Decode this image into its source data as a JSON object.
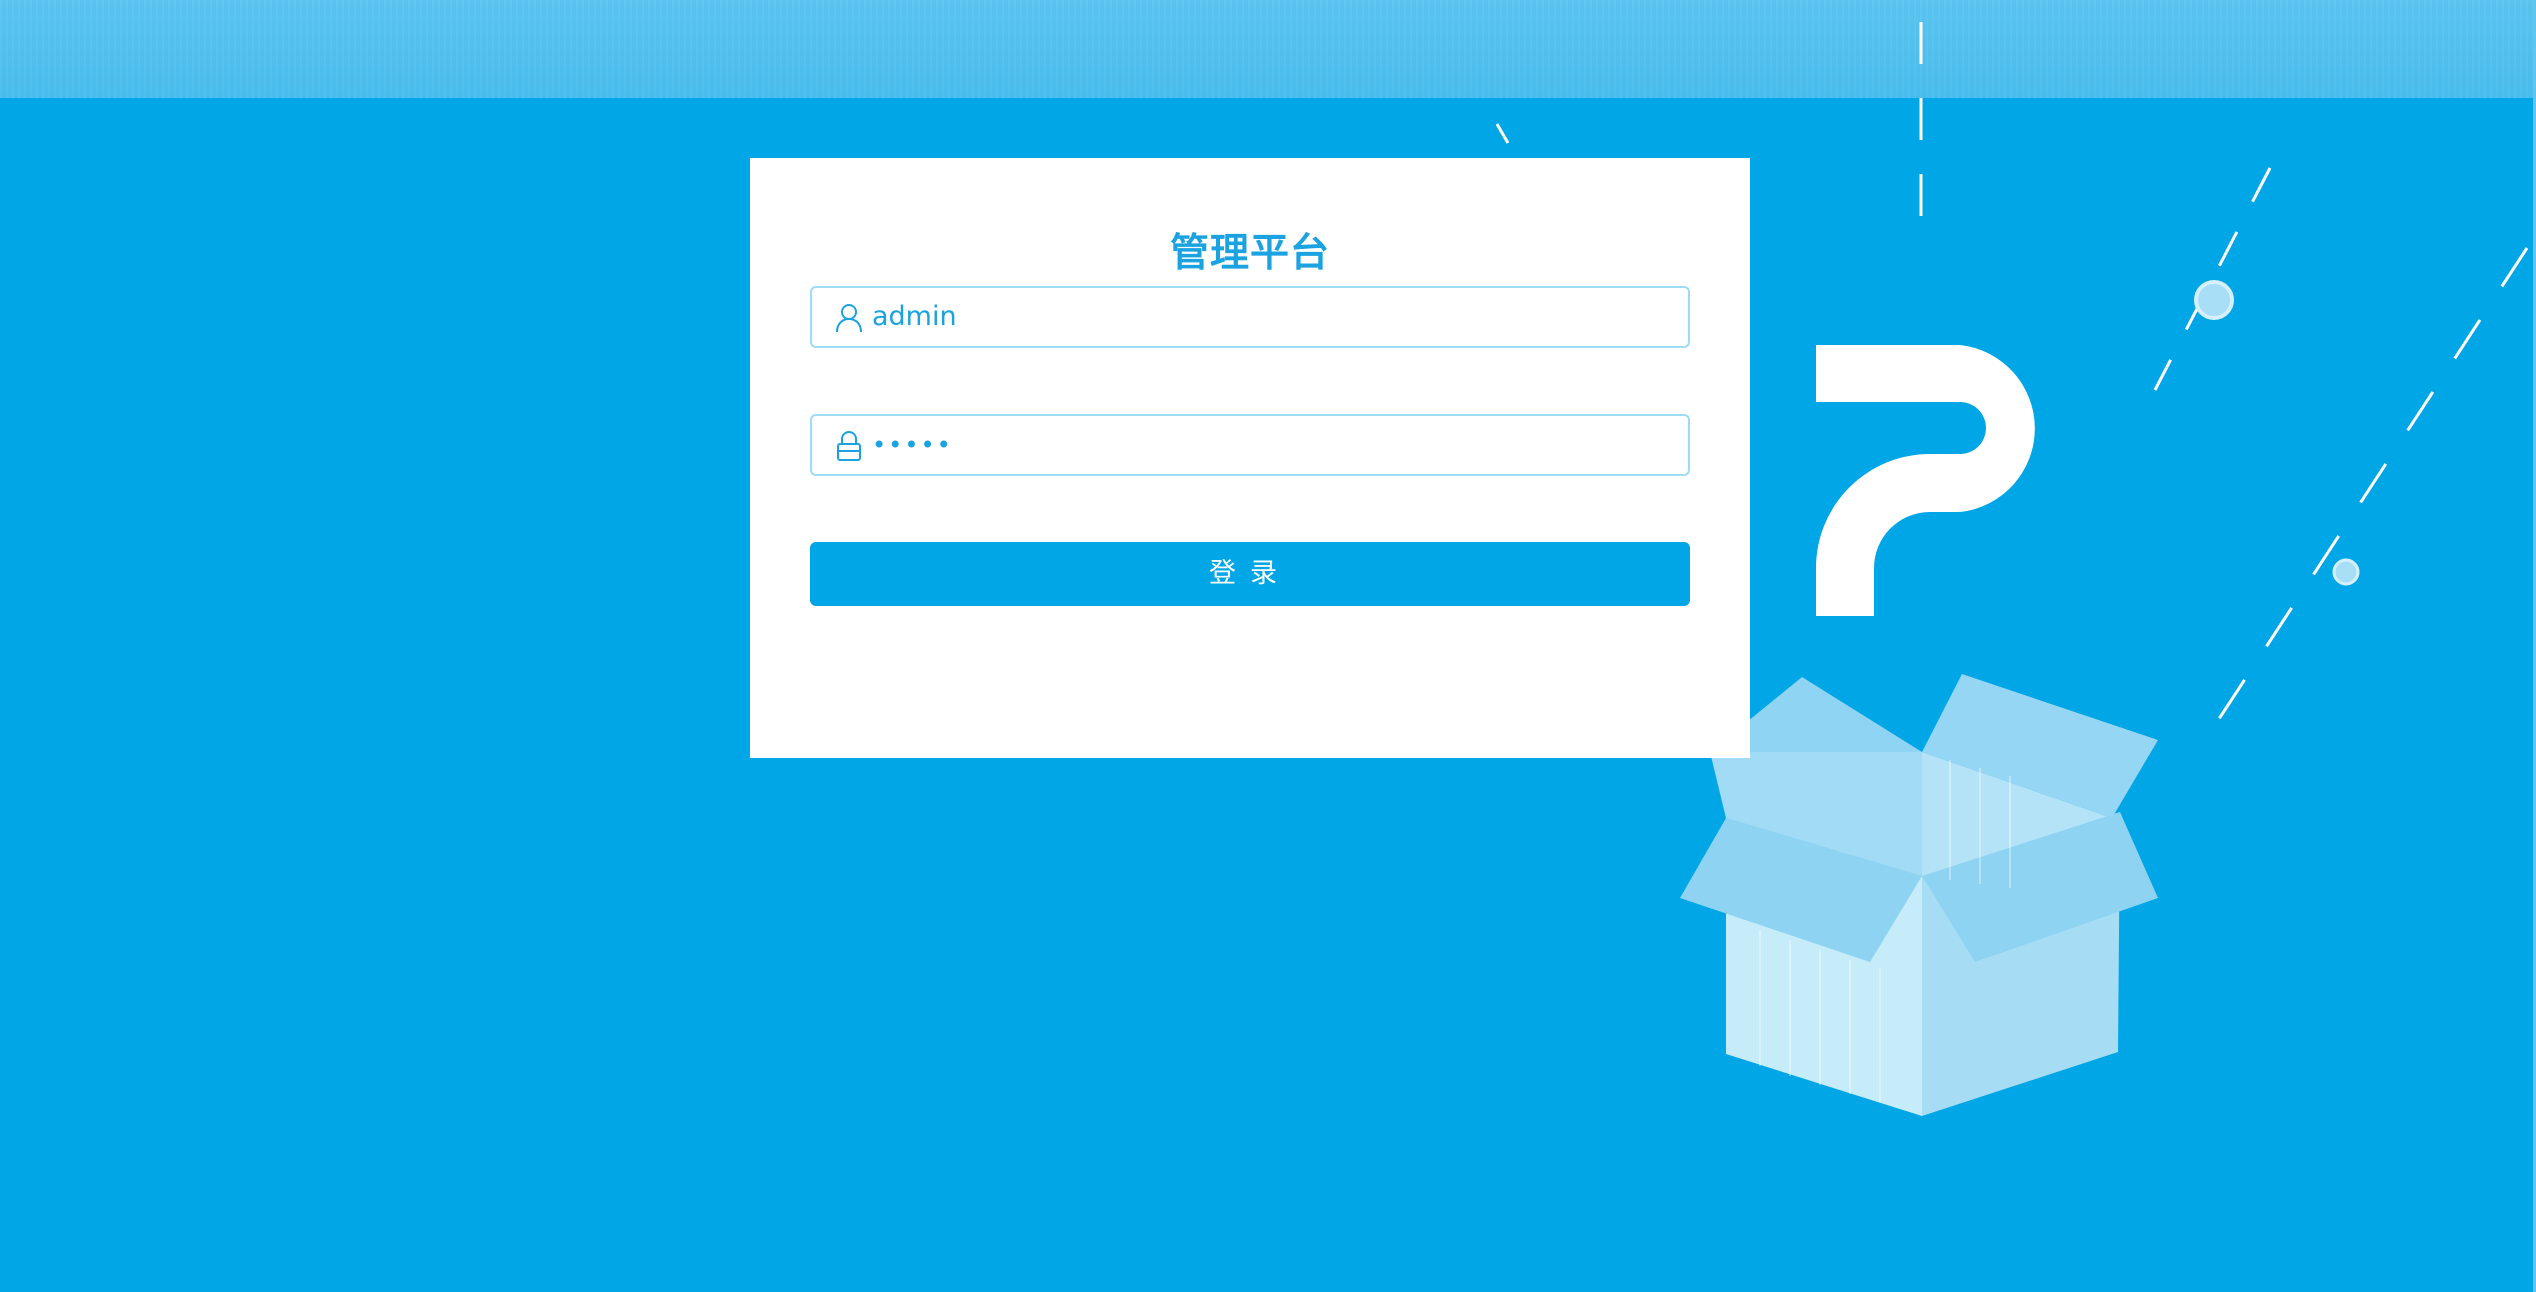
{
  "platform": {
    "title": "管理平台"
  },
  "login": {
    "username_value": "admin",
    "password_value": "•••••",
    "submit_label": "登录"
  },
  "icons": {
    "username": "user-icon",
    "password": "lock-icon",
    "illustration": "open-box-question-illustration"
  },
  "colors": {
    "background": "#00a6e5",
    "accent": "#1aa3e0",
    "card": "#ffffff",
    "field_border": "#9edbf4"
  }
}
